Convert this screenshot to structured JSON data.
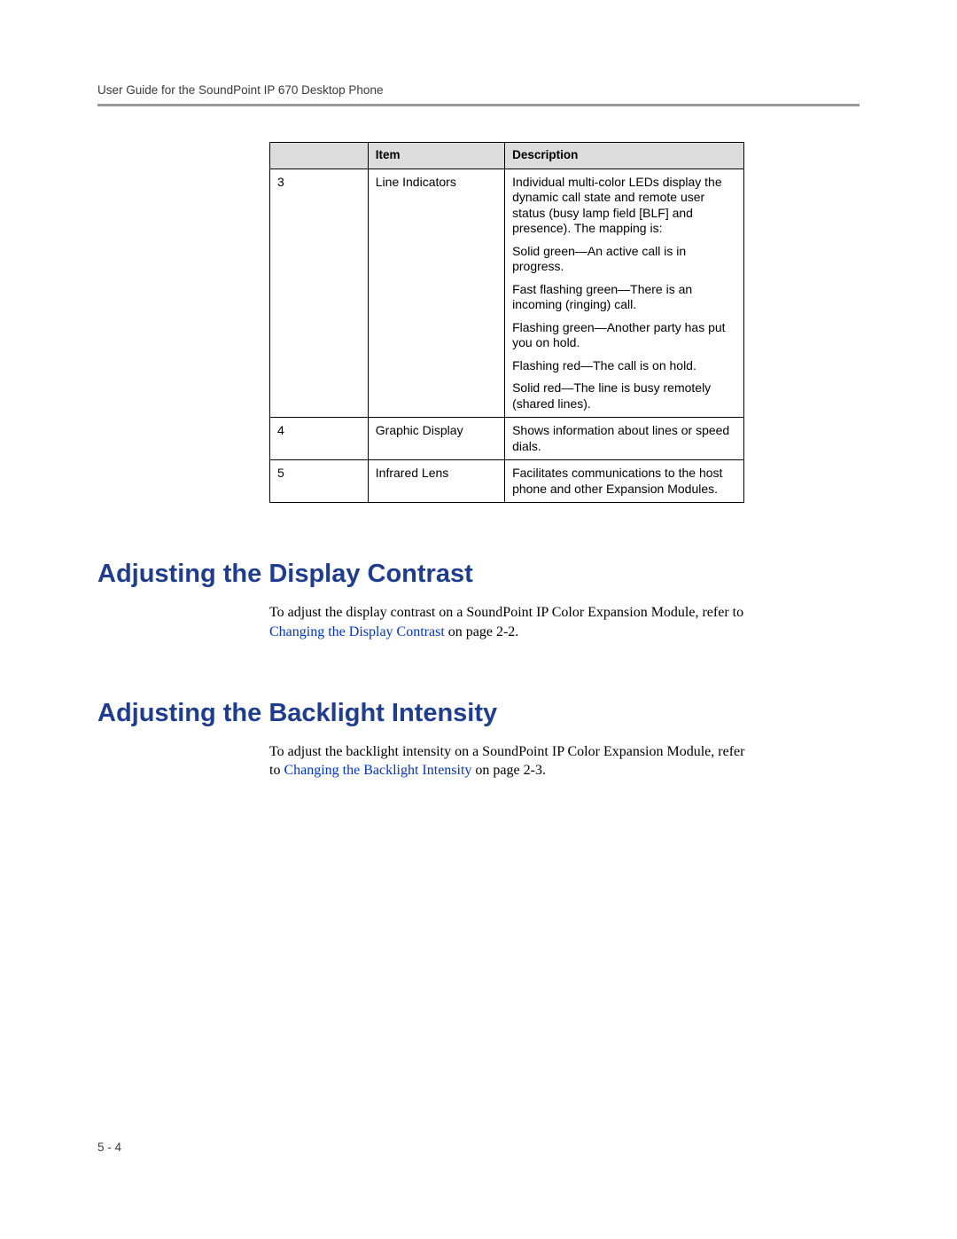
{
  "header": {
    "running_head": "User Guide for the SoundPoint IP 670 Desktop Phone"
  },
  "table": {
    "headers": {
      "num": "",
      "item": "Item",
      "desc": "Description"
    },
    "rows": [
      {
        "num": "3",
        "item": "Line Indicators",
        "desc": [
          "Individual multi-color LEDs display the dynamic call state and remote user status (busy lamp field [BLF] and presence). The mapping is:",
          "Solid green—An active call is in progress.",
          "Fast flashing green—There is an incoming (ringing) call.",
          "Flashing green—Another party has put you on hold.",
          "Flashing red—The call is on hold.",
          "Solid red—The line is busy remotely (shared lines)."
        ]
      },
      {
        "num": "4",
        "item": "Graphic Display",
        "desc": [
          "Shows information about lines or speed dials."
        ]
      },
      {
        "num": "5",
        "item": "Infrared Lens",
        "desc": [
          "Facilitates communications to the host phone and other Expansion Modules."
        ]
      }
    ]
  },
  "sections": {
    "contrast": {
      "heading": "Adjusting the Display Contrast",
      "lead": "To adjust the display contrast on a SoundPoint IP Color Expansion Module, refer to ",
      "link": "Changing the Display Contrast",
      "tail": " on page 2-2."
    },
    "backlight": {
      "heading": "Adjusting the Backlight Intensity",
      "lead": "To adjust the backlight intensity on a SoundPoint IP Color Expansion Module, refer to ",
      "link": "Changing the Backlight Intensity",
      "tail": " on page 2-3."
    }
  },
  "page_number": "5 - 4"
}
